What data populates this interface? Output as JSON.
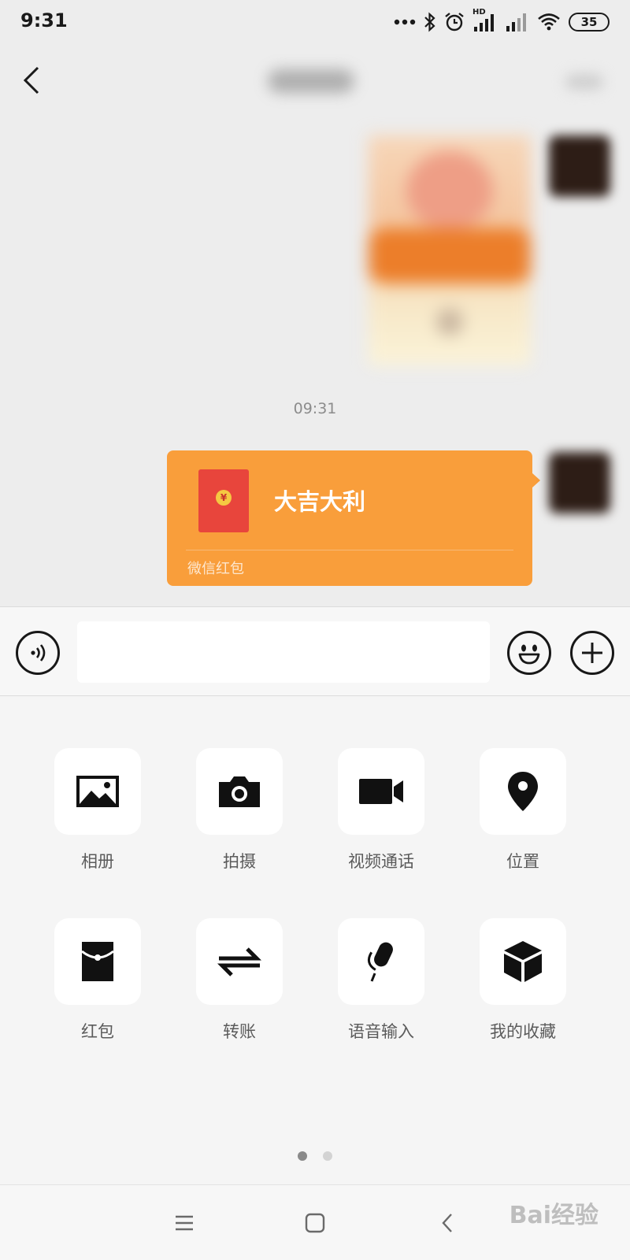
{
  "status_bar": {
    "time": "9:31",
    "network_badge": "HD",
    "battery_level": "35"
  },
  "chat": {
    "timestamp": "09:31",
    "red_packet": {
      "greeting": "大吉大利",
      "footer": "微信红包",
      "coin_glyph": "¥",
      "bubble_color": "#f99e3b",
      "envelope_color": "#e8453c"
    }
  },
  "input_bar": {
    "message_value": ""
  },
  "more_panel": {
    "items": [
      {
        "label": "相册",
        "icon": "photo-album-icon"
      },
      {
        "label": "拍摄",
        "icon": "camera-icon"
      },
      {
        "label": "视频通话",
        "icon": "video-call-icon"
      },
      {
        "label": "位置",
        "icon": "location-pin-icon"
      },
      {
        "label": "红包",
        "icon": "red-packet-icon"
      },
      {
        "label": "转账",
        "icon": "transfer-icon"
      },
      {
        "label": "语音输入",
        "icon": "microphone-icon"
      },
      {
        "label": "我的收藏",
        "icon": "favorites-box-icon"
      }
    ],
    "pagination": {
      "pages": 2,
      "current": 1
    }
  },
  "watermark": "Bai经验"
}
